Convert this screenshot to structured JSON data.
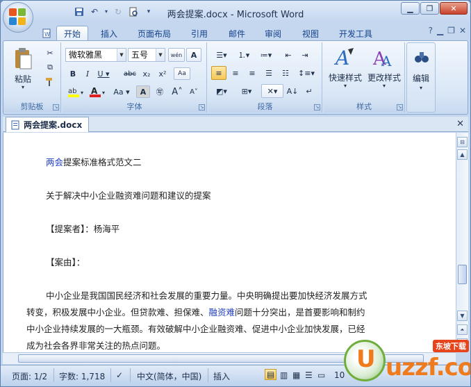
{
  "window": {
    "title": "两会提案.docx - Microsoft Word",
    "minimize_icon": "minimize-icon",
    "restore_icon": "restore-icon",
    "close_icon": "close-icon"
  },
  "tabs": [
    {
      "label": "开始",
      "active": true
    },
    {
      "label": "插入"
    },
    {
      "label": "页面布局"
    },
    {
      "label": "引用"
    },
    {
      "label": "邮件"
    },
    {
      "label": "审阅"
    },
    {
      "label": "视图"
    },
    {
      "label": "开发工具"
    }
  ],
  "ribbon": {
    "clipboard": {
      "label": "剪贴板",
      "paste_label": "粘贴"
    },
    "font": {
      "label": "字体",
      "font_name": "微软雅黑",
      "font_size": "五号"
    },
    "paragraph": {
      "label": "段落"
    },
    "styles": {
      "label": "样式",
      "quick_styles": "快速样式",
      "change_styles": "更改样式"
    },
    "editing": {
      "label": "编辑"
    }
  },
  "document_tab": {
    "name": "两会提案.docx"
  },
  "document": {
    "para1_hl": "两会",
    "para1_rest": "提案标准格式范文二",
    "para2": "关于解决中小企业融资难问题和建议的提案",
    "para3": "【提案者】：杨海平",
    "para4": "【案由】：",
    "para5_line1": "中小企业是我国国民经济和社会发展的重要力量。中央明确提出要加快经济发展方式",
    "para5_line2_a": "转变，积极发展中小企业。但贷款难、担保难、",
    "para5_line2_hl": "融资难",
    "para5_line2_b": "问题十分突出，是首要影响和制约",
    "para5_line3": "中小企业持续发展的一大瓶颈。有效破解中小企业融资难、促进中小企业加快发展，已经",
    "para5_line4": "成为社会各界非常关注的热点问题。"
  },
  "statusbar": {
    "page": "页面: 1/2",
    "words": "字数: 1,718",
    "language": "中文(简体，中国)",
    "mode": "插入",
    "zoom": "10"
  },
  "watermark": {
    "brand": "uzzf.com",
    "badge": "东坡下载"
  },
  "colors": {
    "accent": "#15428b",
    "link_blue": "#1f3dbf",
    "ribbon_bg": "#dae7f6"
  }
}
